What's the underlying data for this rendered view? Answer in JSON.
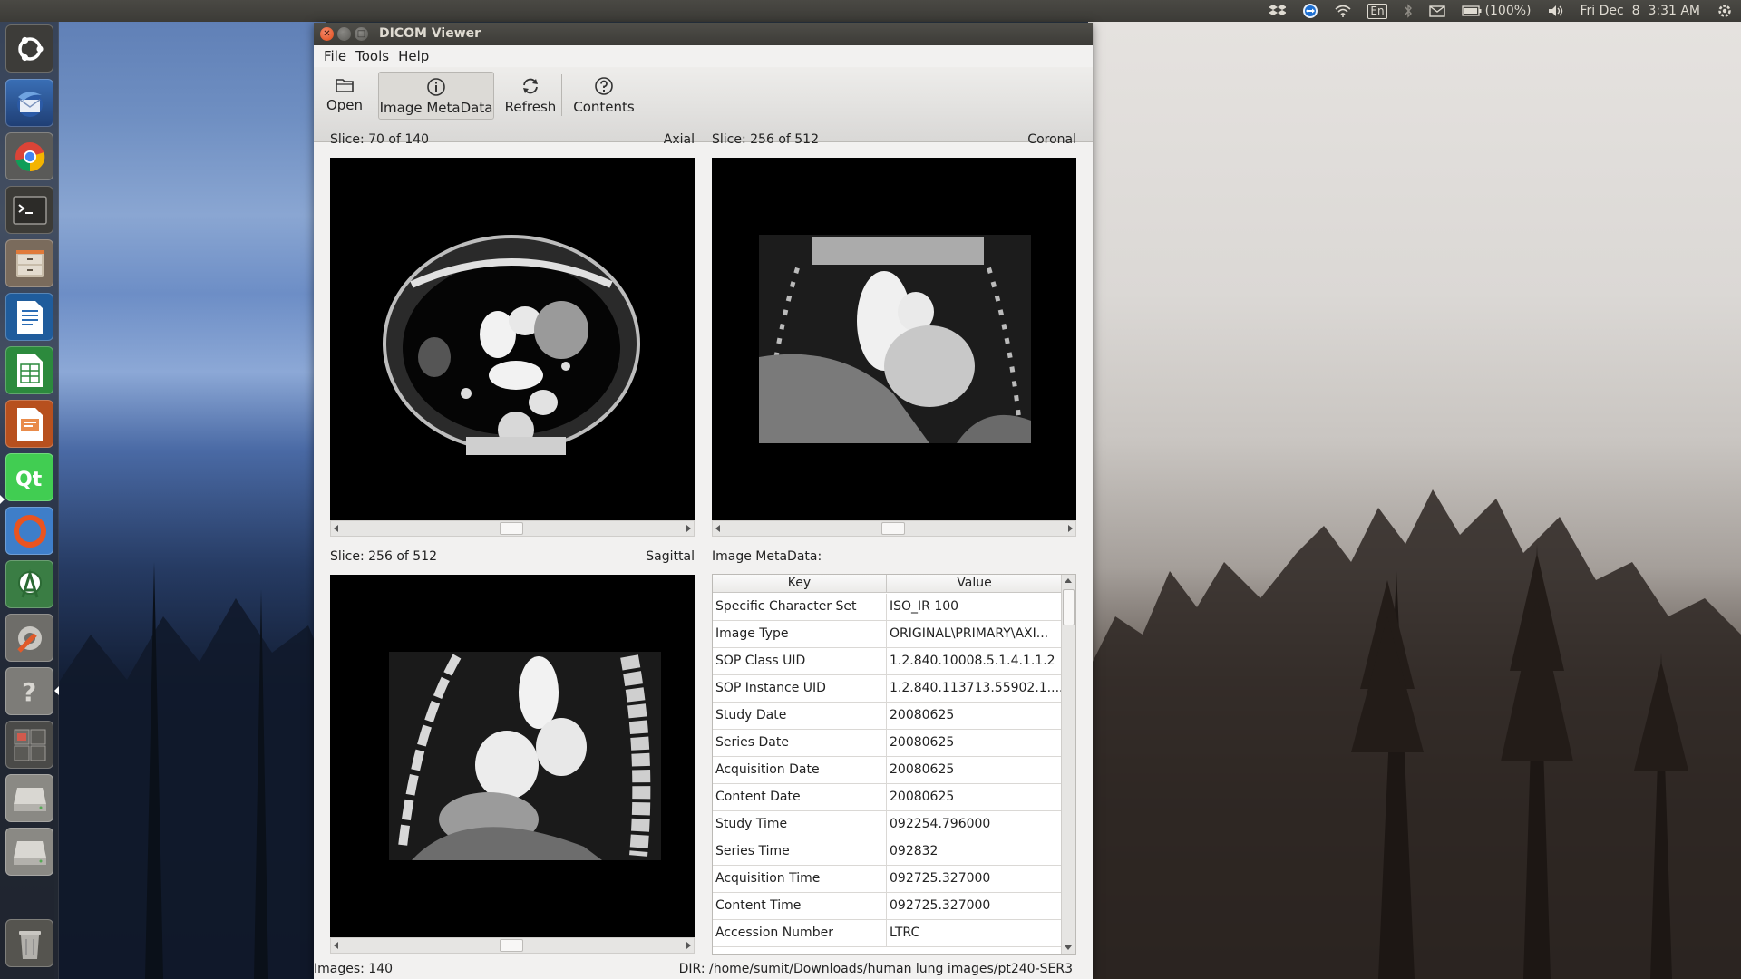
{
  "top_panel": {
    "battery": "(100%)",
    "language": "En",
    "clock": "Fri Dec  8  3:31 AM"
  },
  "window": {
    "title": "DICOM Viewer"
  },
  "menu": {
    "file": "File",
    "tools": "Tools",
    "help": "Help"
  },
  "toolbar": {
    "open": "Open",
    "metadata": "Image MetaData",
    "refresh": "Refresh",
    "contents": "Contents"
  },
  "views": {
    "axial": {
      "slice": "Slice: 70 of 140",
      "plane": "Axial"
    },
    "coronal": {
      "slice": "Slice: 256 of 512",
      "plane": "Coronal"
    },
    "sagittal": {
      "slice": "Slice: 256 of 512",
      "plane": "Sagittal"
    }
  },
  "metadata": {
    "label": "Image MetaData:",
    "key_header": "Key",
    "value_header": "Value",
    "rows": [
      {
        "key": "Specific Character Set",
        "value": "ISO_IR 100"
      },
      {
        "key": "Image Type",
        "value": "ORIGINAL\\PRIMARY\\AXI..."
      },
      {
        "key": "SOP Class UID",
        "value": "1.2.840.10008.5.1.4.1.1.2"
      },
      {
        "key": "SOP Instance UID",
        "value": "1.2.840.113713.55902.1...."
      },
      {
        "key": "Study Date",
        "value": "20080625"
      },
      {
        "key": "Series Date",
        "value": "20080625"
      },
      {
        "key": "Acquisition Date",
        "value": "20080625"
      },
      {
        "key": "Content Date",
        "value": "20080625"
      },
      {
        "key": "Study Time",
        "value": "092254.796000"
      },
      {
        "key": "Series Time",
        "value": "092832"
      },
      {
        "key": "Acquisition Time",
        "value": "092725.327000"
      },
      {
        "key": "Content Time",
        "value": "092725.327000"
      },
      {
        "key": "Accession Number",
        "value": "LTRC"
      }
    ]
  },
  "status": {
    "images": "Images: 140",
    "dir": "DIR: /home/sumit/Downloads/human lung images/pt240-SER3"
  }
}
